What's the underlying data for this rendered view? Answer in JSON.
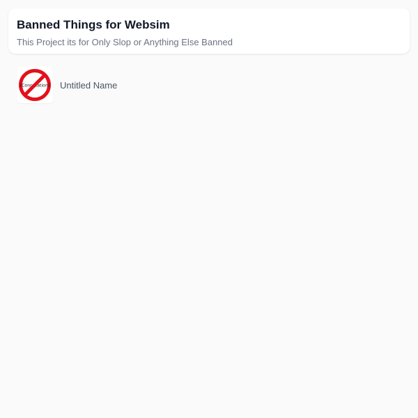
{
  "header": {
    "title": "Banned Things for Websim",
    "subtitle": "This Project its for Only Slop or Anything Else Banned"
  },
  "items": [
    {
      "name": "Untitled Name",
      "image_icon": "prohibition-sign-icon",
      "image_text": "[Connotation]"
    }
  ],
  "colors": {
    "background": "#fafafa",
    "card": "#ffffff",
    "title": "#111827",
    "subtitle": "#6b7280",
    "prohibition_red": "#e3101c"
  }
}
